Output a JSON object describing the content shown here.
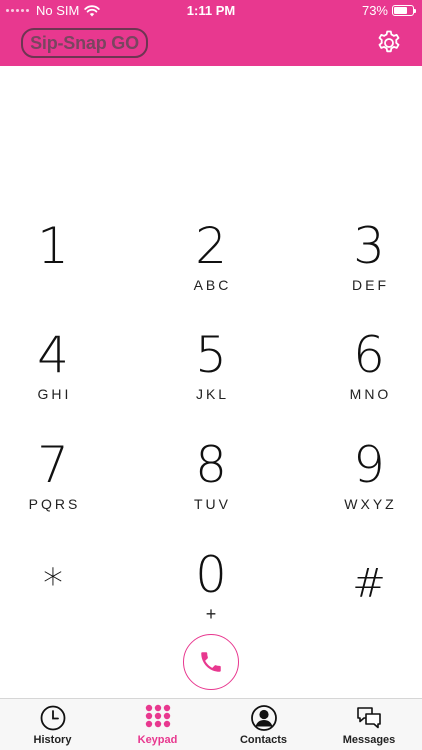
{
  "status_bar": {
    "carrier": "No SIM",
    "time": "1:11 PM",
    "battery_percent": "73%",
    "battery_level": 0.73
  },
  "header": {
    "logo_text": "Sip-Snap GO",
    "settings_icon": "gear-icon",
    "background_color": "#e8388f"
  },
  "keypad": {
    "keys": [
      {
        "digit": "1",
        "letters": ""
      },
      {
        "digit": "2",
        "letters": "ABC"
      },
      {
        "digit": "3",
        "letters": "DEF"
      },
      {
        "digit": "4",
        "letters": "GHI"
      },
      {
        "digit": "5",
        "letters": "JKL"
      },
      {
        "digit": "6",
        "letters": "MNO"
      },
      {
        "digit": "7",
        "letters": "PQRS"
      },
      {
        "digit": "8",
        "letters": "TUV"
      },
      {
        "digit": "9",
        "letters": "WXYZ"
      },
      {
        "digit": "*",
        "letters": ""
      },
      {
        "digit": "0",
        "letters": "+"
      },
      {
        "digit": "#",
        "letters": ""
      }
    ],
    "call_icon": "phone-icon",
    "accent_color": "#e8388f"
  },
  "tabbar": {
    "tabs": [
      {
        "label": "History",
        "icon": "clock-icon",
        "active": false
      },
      {
        "label": "Keypad",
        "icon": "keypad-icon",
        "active": true
      },
      {
        "label": "Contacts",
        "icon": "contact-icon",
        "active": false
      },
      {
        "label": "Messages",
        "icon": "chat-bubbles-icon",
        "active": false
      }
    ]
  }
}
